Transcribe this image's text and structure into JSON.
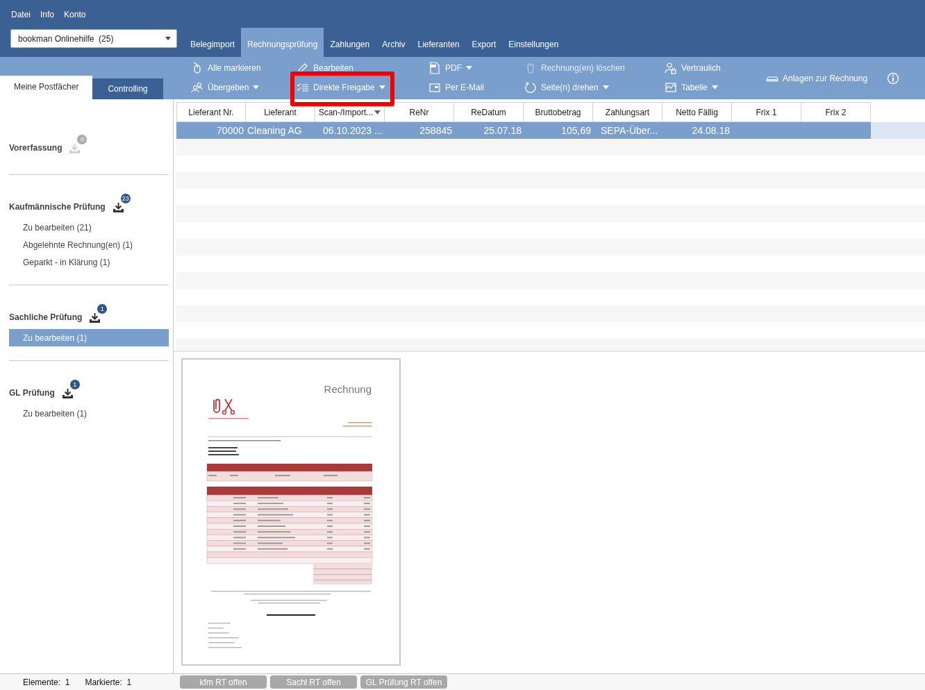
{
  "menu": [
    "Datei",
    "Info",
    "Konto"
  ],
  "mandant_select": {
    "value": "bookman Onlinehilfe  (25)"
  },
  "nav_tabs": [
    {
      "label": "Belegimport",
      "selected": false
    },
    {
      "label": "Rechnungsprüfung",
      "selected": true
    },
    {
      "label": "Zahlungen",
      "selected": false
    },
    {
      "label": "Archiv",
      "selected": false
    },
    {
      "label": "Lieferanten",
      "selected": false
    },
    {
      "label": "Export",
      "selected": false
    },
    {
      "label": "Einstellungen",
      "selected": false
    }
  ],
  "side_tabs": [
    {
      "label": "Meine Postfächer",
      "selected": true
    },
    {
      "label": "Controlling",
      "selected": false
    }
  ],
  "toolbar": {
    "items": [
      {
        "label": "Alle markieren",
        "dropdown": false,
        "disabled": false,
        "highlighted": false
      },
      {
        "label": "Bearbeiten",
        "dropdown": false,
        "disabled": false,
        "highlighted": false
      },
      {
        "label": "PDF",
        "dropdown": true,
        "disabled": false,
        "highlighted": false
      },
      {
        "label": "Rechnung(en) löschen",
        "dropdown": false,
        "disabled": true,
        "highlighted": false
      },
      {
        "label": "Vertraulich",
        "dropdown": false,
        "disabled": false,
        "highlighted": false
      },
      {
        "label": "Übergeben",
        "dropdown": true,
        "disabled": false,
        "highlighted": false
      },
      {
        "label": "Direkte Freigabe",
        "dropdown": true,
        "disabled": false,
        "highlighted": true
      },
      {
        "label": "Per E-Mail",
        "dropdown": false,
        "disabled": false,
        "highlighted": false
      },
      {
        "label": "Seite(n) drehen",
        "dropdown": true,
        "disabled": false,
        "highlighted": false
      },
      {
        "label": "Tabelle",
        "dropdown": true,
        "disabled": false,
        "highlighted": false
      }
    ],
    "attachments_button": "Anlagen zur Rechnung"
  },
  "sidebar": {
    "groups": [
      {
        "title": "Vorerfassung",
        "badge": "0",
        "disabled": true
      },
      {
        "title": "Kaufmännische Prüfung",
        "badge": "23",
        "disabled": false,
        "items": [
          {
            "label": "Zu bearbeiten (21)",
            "selected": false
          },
          {
            "label": "Abgelehnte Rechnung(en) (1)",
            "selected": false
          },
          {
            "label": "Geparkt - in Klärung (1)",
            "selected": false
          }
        ]
      },
      {
        "title": "Sachliche Prüfung",
        "badge": "1",
        "disabled": false,
        "items": [
          {
            "label": "Zu bearbeiten (1)",
            "selected": true
          }
        ]
      },
      {
        "title": "GL Prüfung",
        "badge": "1",
        "disabled": false,
        "items": [
          {
            "label": "Zu bearbeiten (1)",
            "selected": false
          }
        ]
      }
    ]
  },
  "table": {
    "columns": [
      {
        "label": "Lieferant Nr.",
        "sorted": false
      },
      {
        "label": "Lieferant",
        "sorted": false
      },
      {
        "label": "Scan-/Import...",
        "sorted": true
      },
      {
        "label": "ReNr",
        "sorted": false
      },
      {
        "label": "ReDatum",
        "sorted": false
      },
      {
        "label": "Bruttobetrag",
        "sorted": false
      },
      {
        "label": "Zahlungsart",
        "sorted": false
      },
      {
        "label": "Netto Fällig",
        "sorted": false
      },
      {
        "label": "Frix 1",
        "sorted": false
      },
      {
        "label": "Frix 2",
        "sorted": false
      }
    ],
    "rows": [
      {
        "selected": true,
        "cells": [
          "70000",
          "Cleaning AG",
          "06.10.2023 ...",
          "258845",
          "25.07.18",
          "105,69",
          "SEPA-Über...",
          "24.08.18"
        ]
      }
    ]
  },
  "preview": {
    "title": "Rechnung"
  },
  "status_bar": {
    "elements_label": "Elemente:",
    "elements": "1",
    "marked_label": "Markierte:",
    "marked": "1",
    "buttons": [
      {
        "label": "kfm RT offen",
        "disabled": true
      },
      {
        "label": "Sachl RT offen",
        "disabled": true
      },
      {
        "label": "GL Prüfung RT offen",
        "disabled": true
      }
    ]
  }
}
